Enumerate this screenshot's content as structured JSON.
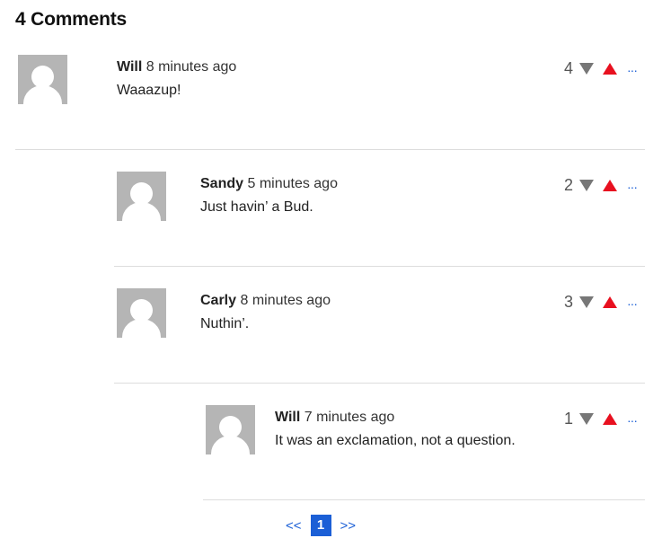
{
  "header": {
    "title": "4 Comments"
  },
  "comments": [
    {
      "author": "Will",
      "time": "8 minutes ago",
      "text": "Waaazup!",
      "votes": "4"
    },
    {
      "author": "Sandy",
      "time": "5 minutes ago",
      "text": "Just havin’ a Bud.",
      "votes": "2"
    },
    {
      "author": "Carly",
      "time": "8 minutes ago",
      "text": "Nuthin’.",
      "votes": "3"
    },
    {
      "author": "Will",
      "time": "7 minutes ago",
      "text": "It was an exclamation, not a question.",
      "votes": "1"
    }
  ],
  "pagination": {
    "prev_label": "<<",
    "current_page": "1",
    "next_label": ">>"
  },
  "icons": {
    "avatar": "default-user-avatar",
    "downvote": "triangle-down",
    "upvote": "triangle-up",
    "more": "ellipsis"
  },
  "colors": {
    "accent": "#1b5fd6",
    "upvote": "#e8101f",
    "downvote": "#777777",
    "avatar_bg": "#b5b5b5"
  }
}
